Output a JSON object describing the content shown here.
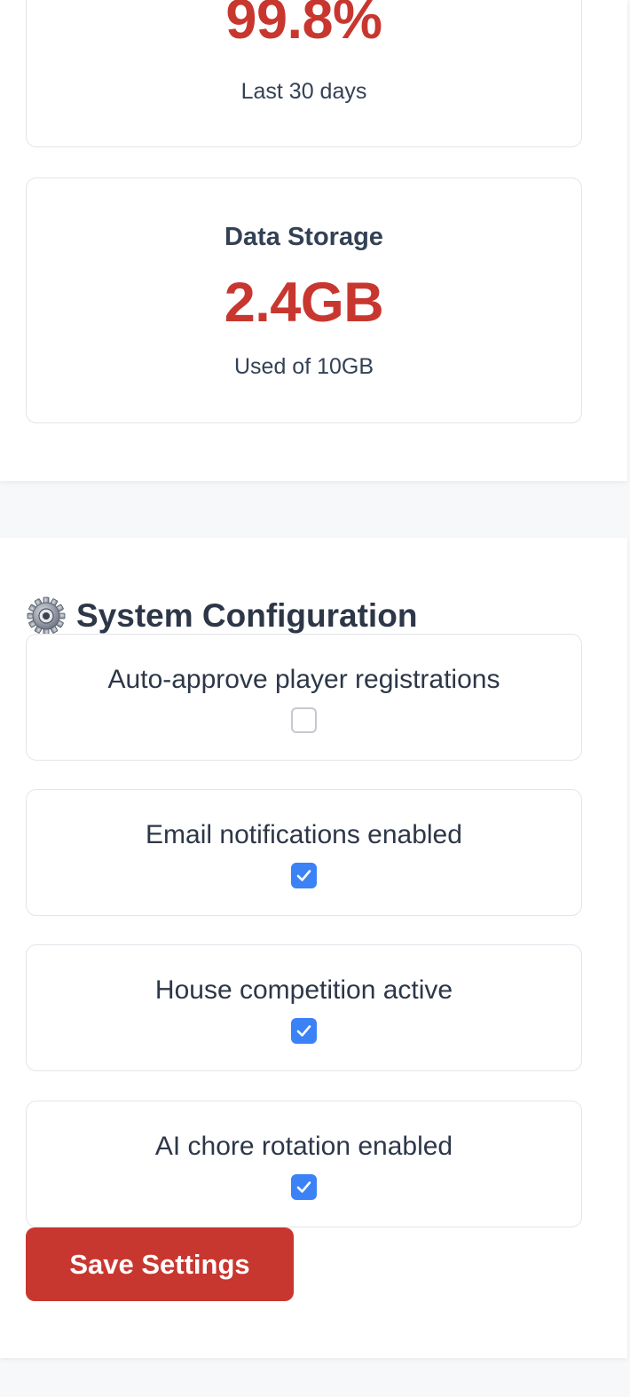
{
  "stats": {
    "uptime": {
      "value": "99.8%",
      "caption": "Last 30 days"
    },
    "storage": {
      "title": "Data Storage",
      "value": "2.4GB",
      "caption": "Used of 10GB"
    }
  },
  "config": {
    "icon": "gear-icon",
    "title": "System Configuration",
    "settings": [
      {
        "label": "Auto-approve player registrations",
        "checked": false
      },
      {
        "label": "Email notifications enabled",
        "checked": true
      },
      {
        "label": "House competition active",
        "checked": true
      },
      {
        "label": "AI chore rotation enabled",
        "checked": true
      }
    ],
    "save_label": "Save Settings"
  },
  "colors": {
    "accent": "#c8372f",
    "checkbox_checked": "#3b82f6",
    "text": "#334155"
  }
}
